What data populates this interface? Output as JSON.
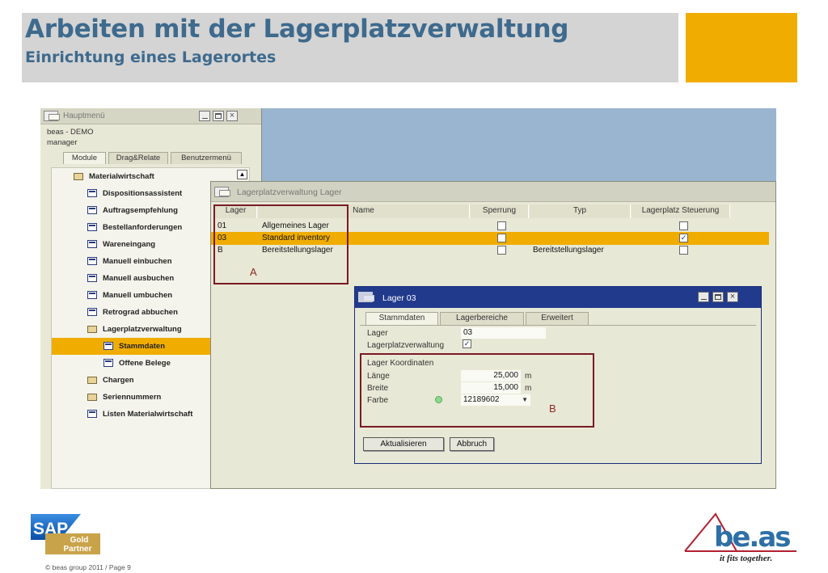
{
  "header": {
    "title": "Arbeiten mit der Lagerplatzverwaltung",
    "subtitle": "Einrichtung eines Lagerortes"
  },
  "main_menu": {
    "title": "Hauptmenü",
    "company": "beas - DEMO",
    "user": "manager",
    "tabs": [
      "Module",
      "Drag&Relate",
      "Benutzermenü"
    ],
    "tree": [
      {
        "label": "Materialwirtschaft",
        "icon": "folder-open-icon",
        "level": 0
      },
      {
        "label": "Dispositionsassistent",
        "icon": "document-icon",
        "level": 1
      },
      {
        "label": "Auftragsempfehlung",
        "icon": "document-icon",
        "level": 1
      },
      {
        "label": "Bestellanforderungen",
        "icon": "document-icon",
        "level": 1
      },
      {
        "label": "Wareneingang",
        "icon": "document-icon",
        "level": 1
      },
      {
        "label": "Manuell einbuchen",
        "icon": "document-icon",
        "level": 1
      },
      {
        "label": "Manuell ausbuchen",
        "icon": "document-icon",
        "level": 1
      },
      {
        "label": "Manuell umbuchen",
        "icon": "document-icon",
        "level": 1
      },
      {
        "label": "Retrograd abbuchen",
        "icon": "document-icon",
        "level": 1
      },
      {
        "label": "Lagerplatzverwaltung",
        "icon": "folder-open-icon",
        "level": 1
      },
      {
        "label": "Stammdaten",
        "icon": "document-icon",
        "level": 2,
        "selected": true
      },
      {
        "label": "Offene Belege",
        "icon": "document-icon",
        "level": 2
      },
      {
        "label": "Chargen",
        "icon": "folder-icon",
        "level": 1
      },
      {
        "label": "Seriennummern",
        "icon": "folder-icon",
        "level": 1
      },
      {
        "label": "Listen Materialwirtschaft",
        "icon": "document-icon",
        "level": 1
      }
    ]
  },
  "lpv_window": {
    "title": "Lagerplatzverwaltung Lager",
    "columns": [
      "Lager",
      "Name",
      "Sperrung",
      "Typ",
      "Lagerplatz Steuerung"
    ],
    "rows": [
      {
        "lager": "01",
        "name": "Allgemeines Lager",
        "sperrung": false,
        "typ": "",
        "steuerung": false,
        "highlighted": false
      },
      {
        "lager": "03",
        "name": "Standard inventory",
        "sperrung": false,
        "typ": "",
        "steuerung": true,
        "highlighted": true
      },
      {
        "lager": "B",
        "name": "Bereitstellungslager",
        "sperrung": false,
        "typ": "Bereitstellungslager",
        "steuerung": false,
        "highlighted": false
      }
    ],
    "annotation_a": "A"
  },
  "lager_dialog": {
    "title": "Lager 03",
    "tabs": [
      "Stammdaten",
      "Lagerbereiche",
      "Erweitert"
    ],
    "lager_label": "Lager",
    "lager_value": "03",
    "lpv_label": "Lagerplatzverwaltung",
    "lpv_checked": true,
    "coords_heading": "Lager Koordinaten",
    "laenge_label": "Länge",
    "laenge_value": "25,000",
    "laenge_unit": "m",
    "breite_label": "Breite",
    "breite_value": "15,000",
    "breite_unit": "m",
    "farbe_label": "Farbe",
    "farbe_value": "12189602",
    "annotation_b": "B",
    "update_button": "Aktualisieren",
    "cancel_button": "Abbruch"
  },
  "footer": {
    "copyright": "© beas group 2011 / Page 9",
    "sap_logo_text": "SAP",
    "sap_badge": [
      "Gold",
      "Partner"
    ],
    "beas_logo": "be.as",
    "beas_tagline": "it fits together."
  },
  "colors": {
    "accent": "#f0ad00",
    "title_blue": "#3e6a8d",
    "annotation_red": "#7a1a24",
    "dialog_titlebar": "#213a8c"
  }
}
